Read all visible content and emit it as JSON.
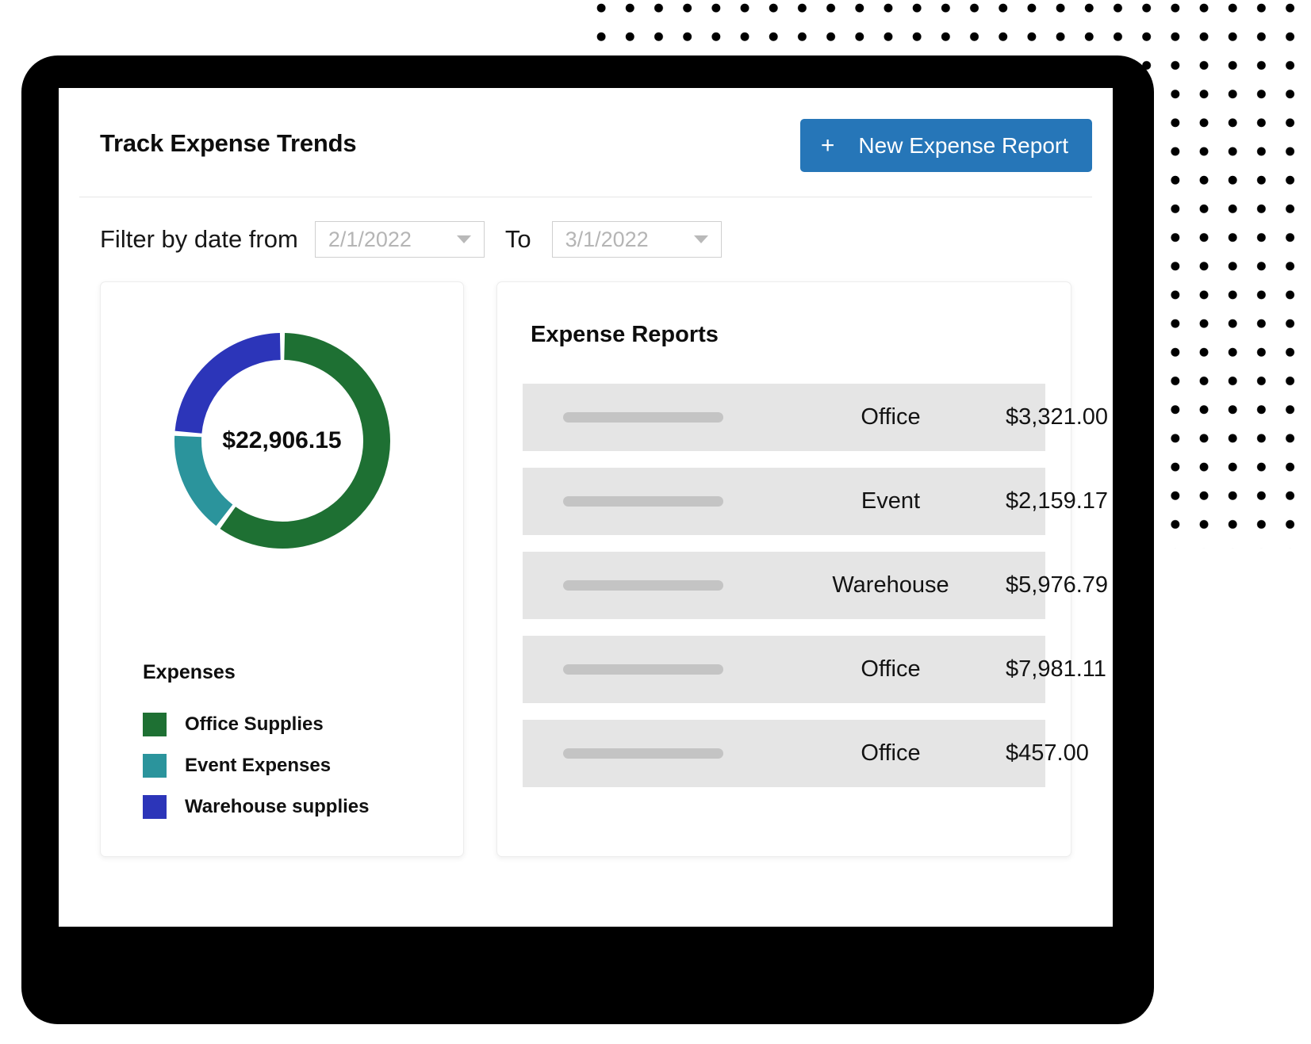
{
  "header": {
    "title": "Track Expense Trends",
    "new_report_button": {
      "plus": "+",
      "label": "New Expense Report"
    }
  },
  "filter": {
    "label": "Filter by date from",
    "to_label": "To",
    "from_date": "2/1/2022",
    "to_date": "3/1/2022"
  },
  "chart_panel": {
    "center_value": "$22,906.15",
    "legend_title": "Expenses",
    "legend": [
      {
        "label": "Office Supplies",
        "color": "#1E7033"
      },
      {
        "label": "Event Expenses",
        "color": "#2B949C"
      },
      {
        "label": "Warehouse supplies",
        "color": "#2C35B9"
      }
    ]
  },
  "reports_panel": {
    "title": "Expense Reports",
    "rows": [
      {
        "category": "Office",
        "amount": "$3,321.00"
      },
      {
        "category": "Event",
        "amount": "$2,159.17"
      },
      {
        "category": "Warehouse",
        "amount": "$5,976.79"
      },
      {
        "category": "Office",
        "amount": "$7,981.11"
      },
      {
        "category": "Office",
        "amount": "$457.00"
      }
    ]
  },
  "chart_data": {
    "type": "pie",
    "variant": "donut",
    "title": "Expenses",
    "center_label": "$22,906.15",
    "total": 22906.15,
    "categories": [
      "Office Supplies",
      "Event Expenses",
      "Warehouse supplies"
    ],
    "values": [
      13780.0,
      3650.0,
      5476.15
    ],
    "percentages": [
      60.2,
      15.9,
      23.9
    ],
    "colors": [
      "#1E7033",
      "#2B949C",
      "#2C35B9"
    ],
    "start_angle_deg": 0,
    "direction": "clockwise",
    "inner_radius_ratio": 0.76,
    "legend_position": "bottom-left",
    "grid": false
  },
  "theme": {
    "accent": "#2676B8",
    "frame": "#000000",
    "row_bg": "#E5E5E5",
    "placeholder_bar": "#C4C4C4"
  }
}
